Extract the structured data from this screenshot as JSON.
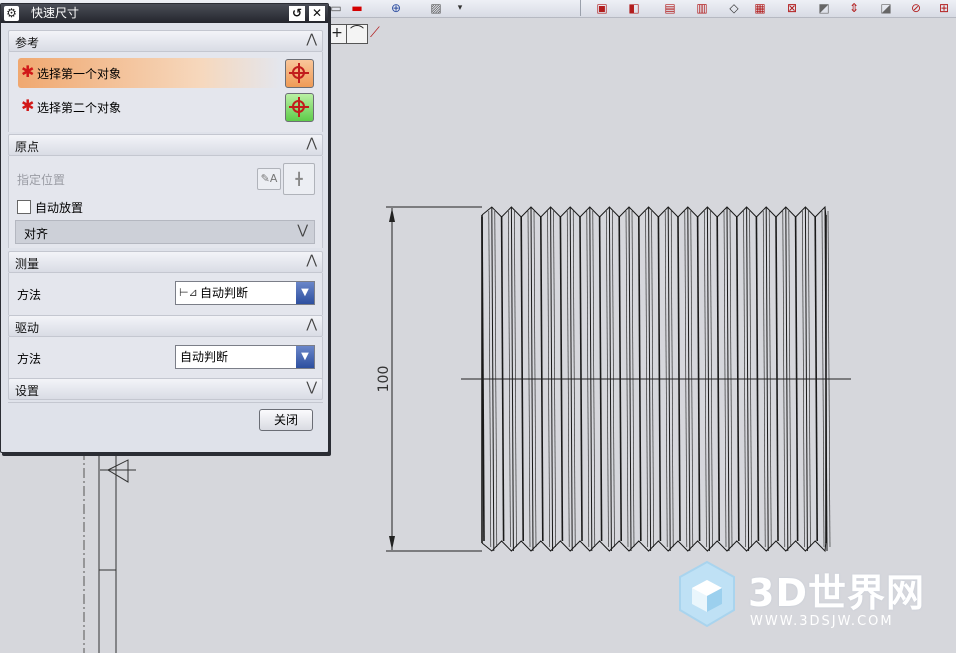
{
  "dialog": {
    "title": "快速尺寸",
    "sections": {
      "reference": {
        "label": "参考",
        "select_first": "选择第一个对象",
        "select_second": "选择第二个对象"
      },
      "origin": {
        "label": "原点",
        "specify_location": "指定位置",
        "auto_place": "自动放置",
        "align_value": "对齐"
      },
      "measure": {
        "label": "测量",
        "method_label": "方法",
        "method_value": "自动判断"
      },
      "driving": {
        "label": "驱动",
        "method_label": "方法",
        "method_value": "自动判断"
      },
      "settings": {
        "label": "设置"
      }
    },
    "close_label": "关闭"
  },
  "drawing": {
    "dimension_value": "100"
  },
  "watermark": {
    "brand": "3D世界网",
    "url": "WWW.3DSJW.COM"
  },
  "colors": {
    "highlight_orange": "#f0b07a",
    "required_red": "#d11818",
    "title_bar": "#2a2c33"
  }
}
